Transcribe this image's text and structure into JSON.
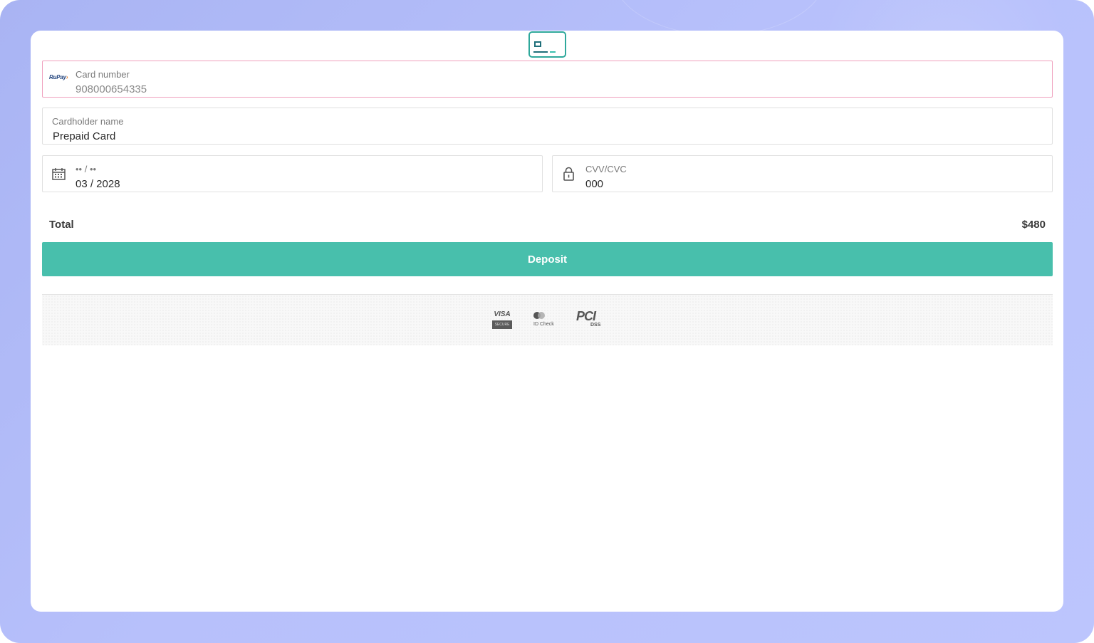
{
  "form": {
    "card_number": {
      "label": "Card number",
      "value": "908000654335",
      "brand": "RuPay"
    },
    "cardholder": {
      "label": "Cardholder name",
      "value": "Prepaid Card"
    },
    "expiry": {
      "label": "•• / ••",
      "value": "03 / 2028"
    },
    "cvv": {
      "label": "CVV/CVC",
      "value": "000"
    }
  },
  "summary": {
    "total_label": "Total",
    "total_value": "$480"
  },
  "actions": {
    "deposit_label": "Deposit"
  },
  "badges": {
    "visa": {
      "top": "VISA",
      "bottom": "SECURE"
    },
    "mastercard": {
      "label": "ID Check"
    },
    "pci": {
      "top": "PCI",
      "bottom": "DSS"
    }
  },
  "colors": {
    "accent": "#48bfac",
    "error_border": "#ef9fbd",
    "background": "#b7c0fb"
  }
}
